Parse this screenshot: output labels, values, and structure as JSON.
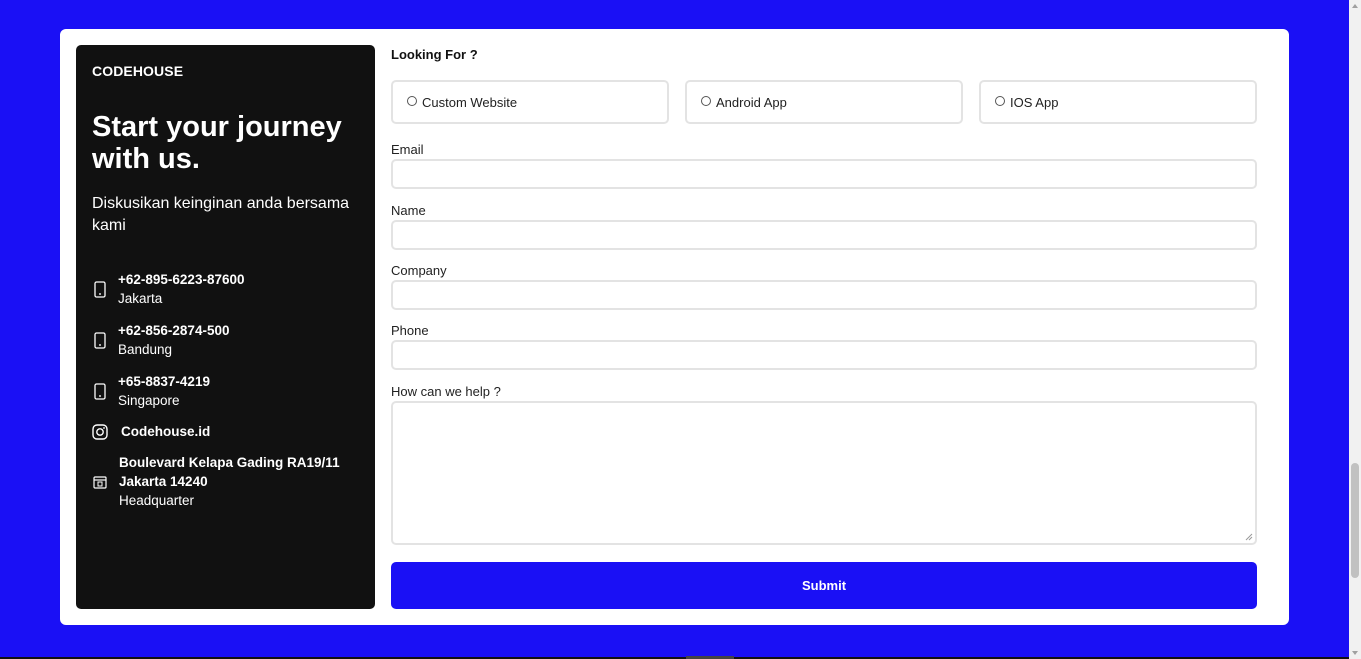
{
  "colors": {
    "background": "#1a10f5",
    "panel": "#111111",
    "accent": "#1a10f5"
  },
  "sidebar": {
    "brand": "CODEHOUSE",
    "headline": "Start your journey with us.",
    "subtitle": "Diskusikan keinginan anda bersama kami",
    "contacts": [
      {
        "icon": "phone-icon",
        "main": "+62-895-6223-87600",
        "sub": "Jakarta"
      },
      {
        "icon": "phone-icon",
        "main": "+62-856-2874-500",
        "sub": "Bandung"
      },
      {
        "icon": "phone-icon",
        "main": "+65-8837-4219",
        "sub": "Singapore"
      },
      {
        "icon": "instagram-icon",
        "main": "Codehouse.id",
        "sub": ""
      },
      {
        "icon": "building-icon",
        "main": "Boulevard Kelapa Gading RA19/11",
        "main2": "Jakarta 14240",
        "sub": "Headquarter"
      }
    ]
  },
  "form": {
    "looking_for_label": "Looking For ?",
    "options": [
      "Custom Website",
      "Android App",
      "IOS App"
    ],
    "fields": {
      "email_label": "Email",
      "name_label": "Name",
      "company_label": "Company",
      "phone_label": "Phone",
      "help_label": "How can we help ?"
    },
    "submit_label": "Submit"
  }
}
